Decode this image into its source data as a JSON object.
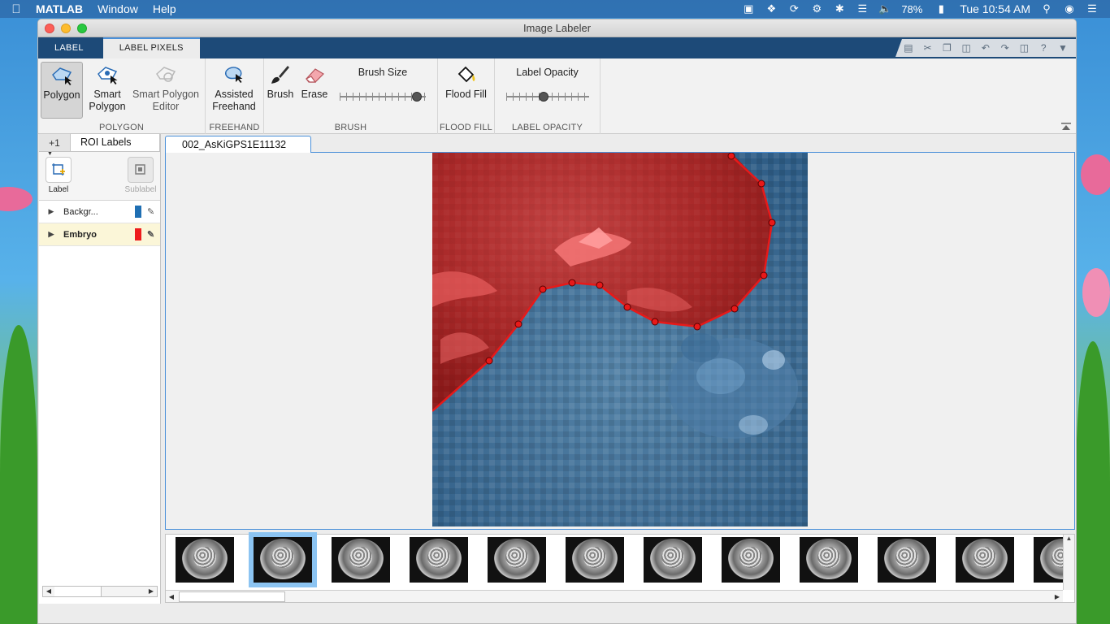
{
  "menubar": {
    "app_name": "MATLAB",
    "menus": [
      "Window",
      "Help"
    ],
    "battery": "78%",
    "clock": "Tue 10:54 AM"
  },
  "window": {
    "title": "Image Labeler"
  },
  "tabs": {
    "label": "LABEL",
    "label_pixels": "LABEL PIXELS"
  },
  "ribbon": {
    "polygon": "Polygon",
    "smart_polygon_1": "Smart",
    "smart_polygon_2": "Polygon",
    "smart_polygon_editor_1": "Smart Polygon",
    "smart_polygon_editor_2": "Editor",
    "group_polygon": "POLYGON",
    "assisted_freehand_1": "Assisted",
    "assisted_freehand_2": "Freehand",
    "group_freehand": "FREEHAND",
    "brush": "Brush",
    "erase": "Erase",
    "brush_size": "Brush Size",
    "brush_size_level": 0.95,
    "group_brush": "BRUSH",
    "flood_fill": "Flood Fill",
    "group_flood_fill": "FLOOD FILL",
    "label_opacity": "Label Opacity",
    "label_opacity_level": 0.45,
    "group_label_opacity": "LABEL OPACITY"
  },
  "left_panel": {
    "tab_small": "+1",
    "tab": "ROI Labels",
    "tool_label": "Label",
    "tool_sublabel": "Sublabel",
    "labels": [
      {
        "name": "Backgr...",
        "color": "#1f6fb3"
      },
      {
        "name": "Embryo",
        "color": "#ee1c1c"
      }
    ]
  },
  "document": {
    "tab": "002_AsKiGPS1E11132"
  },
  "colors": {
    "ribbon_tab_bar": "#1d4a78",
    "accent": "#4a90d9",
    "polygon_line": "#e81919"
  }
}
